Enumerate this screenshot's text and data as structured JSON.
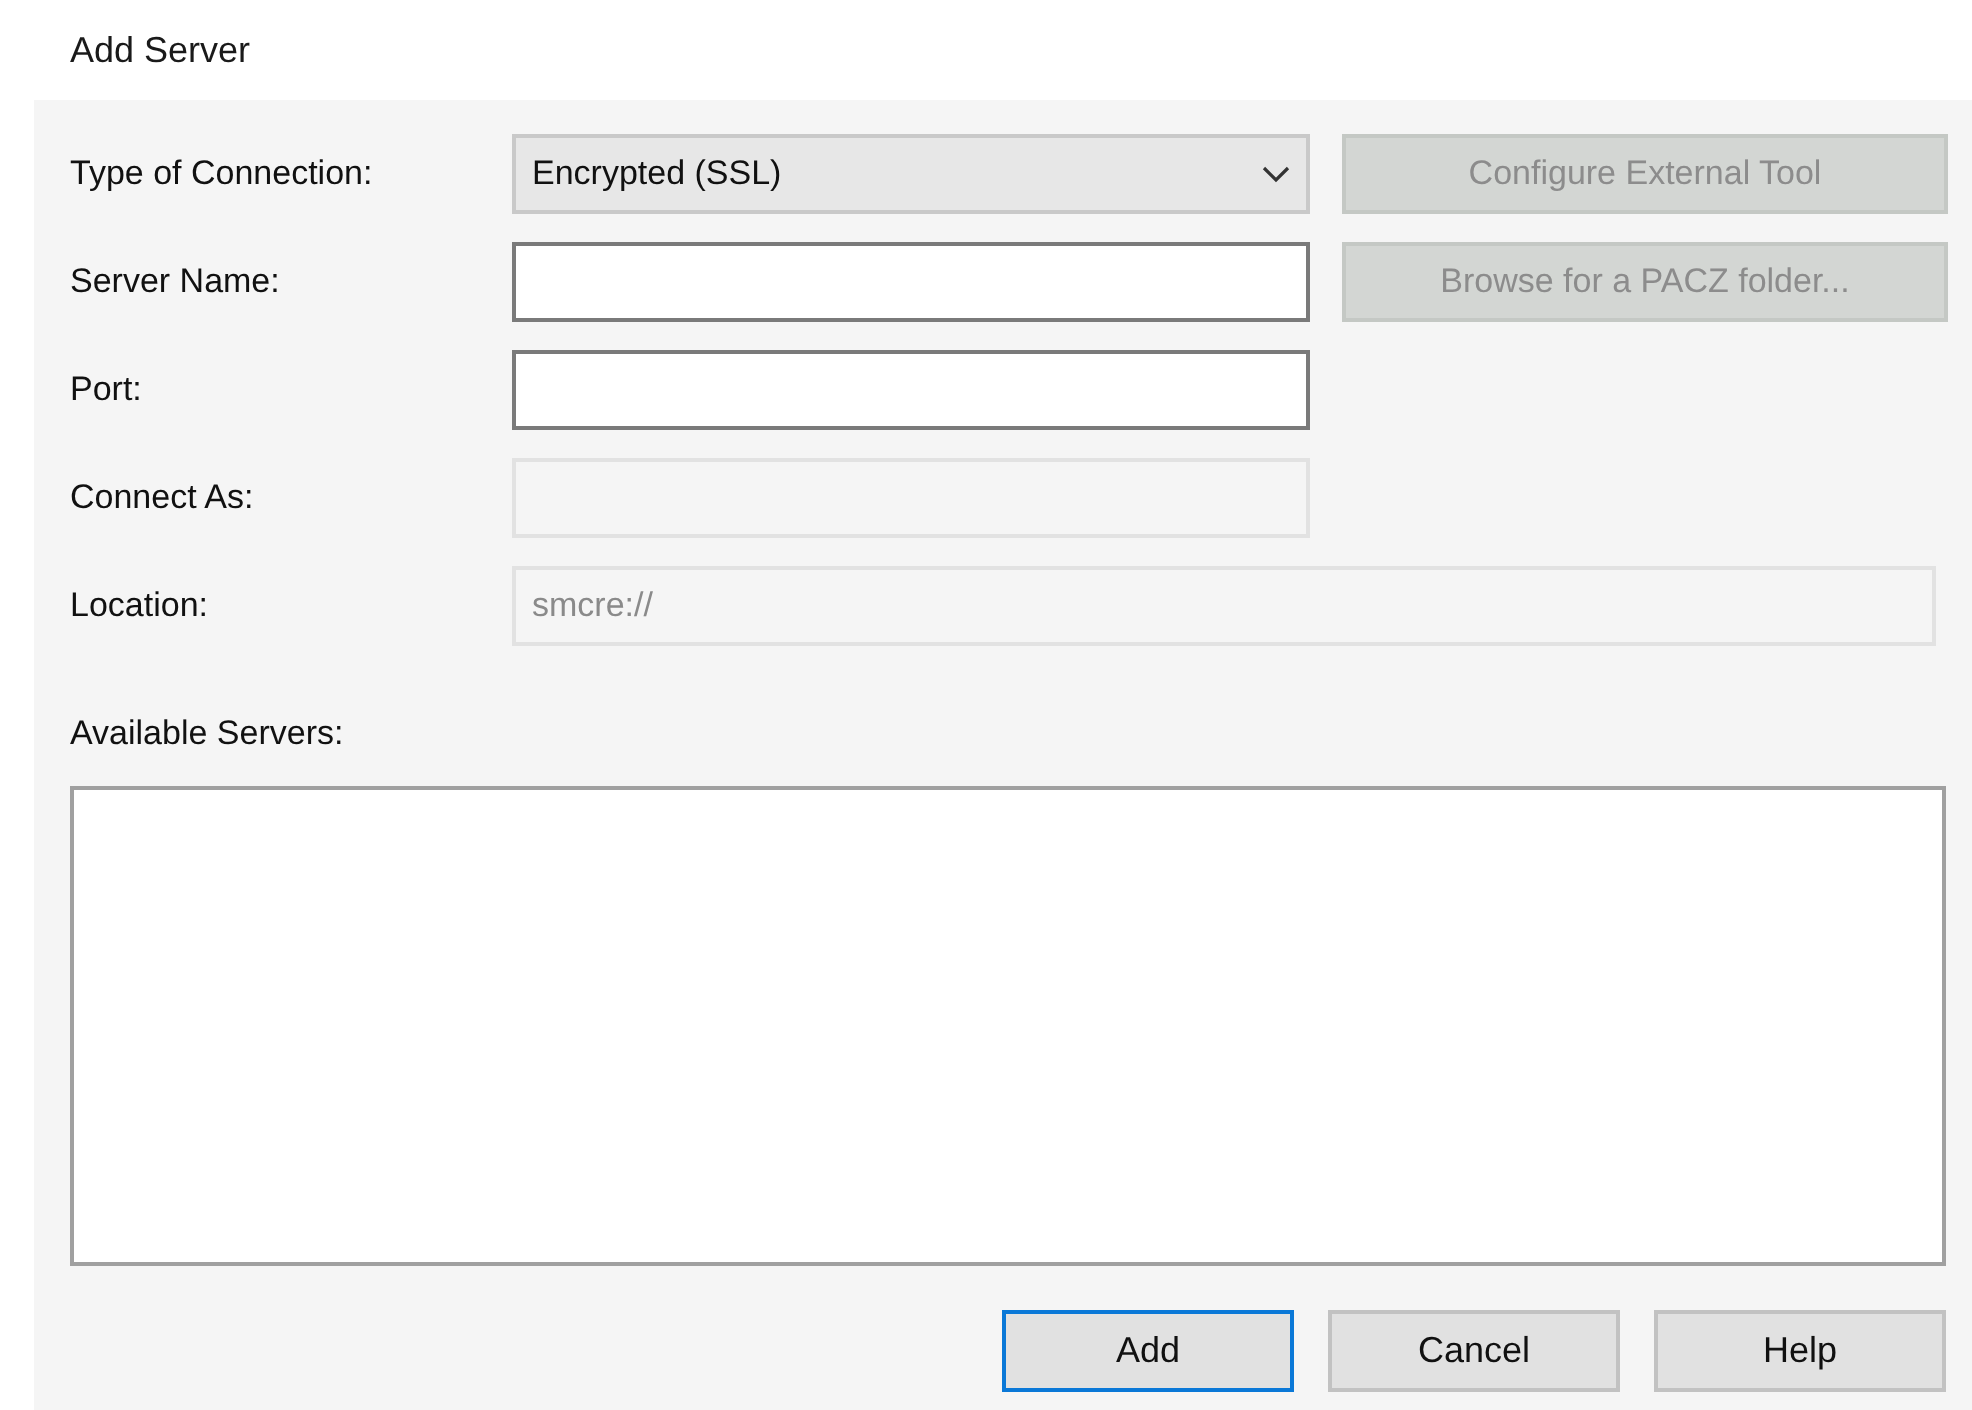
{
  "window": {
    "title": "Add Server"
  },
  "fields": [
    {
      "label": "Type of Connection:",
      "kind": "select",
      "value": "Encrypted (SSL)",
      "disabled": false
    },
    {
      "label": "Server Name:",
      "kind": "input",
      "disabled": false
    },
    {
      "label": "Port:",
      "kind": "input",
      "disabled": false
    },
    {
      "label": "Connect As:",
      "kind": "input",
      "disabled": true
    },
    {
      "label": "Location:",
      "kind": "wide-input",
      "value": "smcre://",
      "disabled": true
    }
  ],
  "side_buttons": [
    {
      "label": "Configure External Tool",
      "disabled": true
    },
    {
      "label": "Browse for a PACZ folder...",
      "disabled": true
    }
  ],
  "servers": {
    "label": "Available Servers:"
  },
  "buttons": [
    {
      "label": "Add",
      "default": true
    },
    {
      "label": "Cancel",
      "default": false
    },
    {
      "label": "Help",
      "default": false
    }
  ]
}
